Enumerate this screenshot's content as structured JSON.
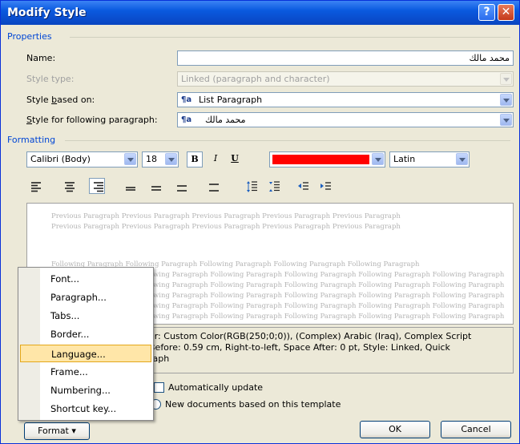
{
  "dialog": {
    "title": "Modify Style",
    "help_label": "?",
    "close_label": "✕"
  },
  "properties": {
    "section_label": "Properties",
    "name_label": "Name:",
    "name_value": "محمد مالك",
    "style_type_label": "Style type:",
    "style_type_value": "Linked (paragraph and character)",
    "based_on_label": "Style based on:",
    "based_on_value": "List Paragraph",
    "following_label": "Style for following paragraph:",
    "following_value": "محمد مالك",
    "style_icon": "¶a"
  },
  "formatting": {
    "section_label": "Formatting",
    "font_value": "Calibri (Body)",
    "size_value": "18",
    "bold_label": "B",
    "italic_label": "I",
    "underline_label": "U",
    "color_value": "#ff0000",
    "script_value": "Latin"
  },
  "preview": {
    "previous_line1": "Previous Paragraph Previous Paragraph Previous Paragraph Previous Paragraph Previous Paragraph",
    "previous_line2": "Previous Paragraph Previous Paragraph Previous Paragraph Previous Paragraph Previous Paragraph",
    "following_line1": "Following Paragraph Following Paragraph Following Paragraph Following Paragraph Following Paragraph",
    "following_line2": "wing Paragraph Following Paragraph Following Paragraph Following Paragraph Following Paragraph",
    "following_line3": "wing Paragraph Following Paragraph Following Paragraph Following Paragraph Following Paragraph",
    "following_line4": "wing Paragraph Following Paragraph Following Paragraph Following Paragraph Following Paragraph",
    "following_line5": "wing Paragraph Following Paragraph Following Paragraph Following Paragraph Following Paragraph",
    "following_line6": "wing Paragraph Following Paragraph Following Paragraph Following Paragraph Following Paragraph"
  },
  "description": {
    "line1": "or: Custom Color(RGB(250;0;0)), (Complex) Arabic (Iraq), Complex Script",
    "line2": "Before:  0.59 cm, Right-to-left, Space After:  0 pt, Style: Linked, Quick",
    "line3": "raph"
  },
  "options": {
    "auto_update_label": "Automatically update",
    "new_docs_label": "New documents based on this template"
  },
  "buttons": {
    "format_label": "Format ▾",
    "ok_label": "OK",
    "cancel_label": "Cancel"
  },
  "format_menu": {
    "items": [
      "Font...",
      "Paragraph...",
      "Tabs...",
      "Border...",
      "Language...",
      "Frame...",
      "Numbering...",
      "Shortcut key..."
    ],
    "highlighted": "Language..."
  }
}
